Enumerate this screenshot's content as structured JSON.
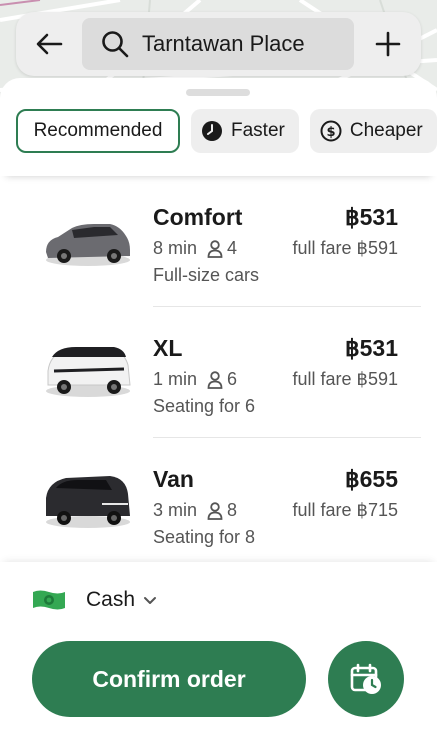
{
  "header": {
    "search_text": "Tarntawan Place"
  },
  "filters": [
    {
      "label": "Recommended",
      "icon": "none",
      "active": true
    },
    {
      "label": "Faster",
      "icon": "clock-icon",
      "active": false
    },
    {
      "label": "Cheaper",
      "icon": "dollar-coin-icon",
      "active": false
    }
  ],
  "rides": [
    {
      "name": "Comfort",
      "price": "฿531",
      "eta": "8 min",
      "seats": "4",
      "full_fare": "full fare ฿591",
      "description": "Full-size cars",
      "car_color": "#6b6b70"
    },
    {
      "name": "XL",
      "price": "฿531",
      "eta": "1 min",
      "seats": "6",
      "full_fare": "full fare ฿591",
      "description": "Seating for 6",
      "car_color": "#f2f2f2"
    },
    {
      "name": "Van",
      "price": "฿655",
      "eta": "3 min",
      "seats": "8",
      "full_fare": "full fare ฿715",
      "description": "Seating for 8",
      "car_color": "#2b2b2f"
    }
  ],
  "payment": {
    "method": "Cash",
    "icon": "cash-icon"
  },
  "actions": {
    "confirm_label": "Confirm order",
    "schedule_icon": "calendar-clock-icon"
  },
  "colors": {
    "accent": "#2e7d52",
    "chip_bg": "#eeeeee",
    "cash_green": "#34a853"
  }
}
